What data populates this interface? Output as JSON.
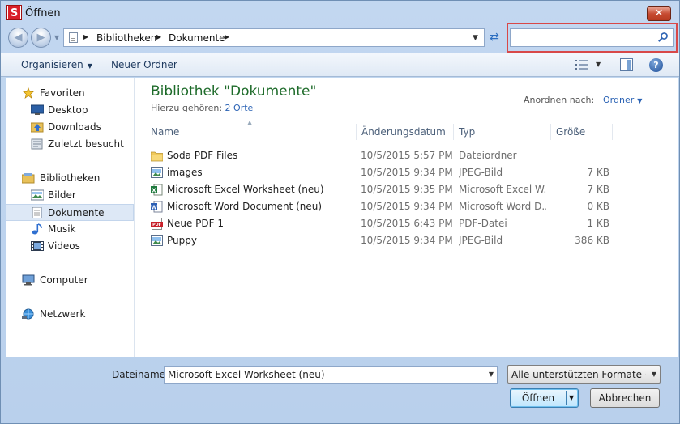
{
  "window": {
    "title": "Öffnen",
    "app_icon_letter": "S",
    "close_label": "✕"
  },
  "address": {
    "crumbs": [
      "Bibliotheken",
      "Dokumente"
    ]
  },
  "search": {
    "value": "",
    "placeholder": ""
  },
  "toolbar": {
    "organize_label": "Organisieren",
    "new_folder_label": "Neuer Ordner"
  },
  "sidebar": {
    "favorites": {
      "label": "Favoriten",
      "items": [
        "Desktop",
        "Downloads",
        "Zuletzt besucht"
      ]
    },
    "libraries": {
      "label": "Bibliotheken",
      "items": [
        "Bilder",
        "Dokumente",
        "Musik",
        "Videos"
      ]
    },
    "computer": "Computer",
    "network": "Netzwerk",
    "selected": "Dokumente"
  },
  "library": {
    "title": "Bibliothek \"Dokumente\"",
    "subtitle_prefix": "Hierzu gehören:",
    "subtitle_link": "2 Orte",
    "arrange_label": "Anordnen nach:",
    "arrange_value": "Ordner"
  },
  "columns": {
    "name": "Name",
    "date": "Änderungsdatum",
    "type": "Typ",
    "size": "Größe"
  },
  "files": [
    {
      "name": "Soda PDF Files",
      "date": "10/5/2015 5:57 PM",
      "type": "Dateiordner",
      "size": "",
      "icon": "folder-icon"
    },
    {
      "name": "images",
      "date": "10/5/2015 9:34 PM",
      "type": "JPEG-Bild",
      "size": "7 KB",
      "icon": "image-icon"
    },
    {
      "name": "Microsoft Excel Worksheet (neu)",
      "date": "10/5/2015 9:35 PM",
      "type": "Microsoft Excel W...",
      "size": "7 KB",
      "icon": "excel-icon"
    },
    {
      "name": "Microsoft Word Document (neu)",
      "date": "10/5/2015 9:34 PM",
      "type": "Microsoft Word D...",
      "size": "0 KB",
      "icon": "word-icon"
    },
    {
      "name": "Neue PDF 1",
      "date": "10/5/2015 6:43 PM",
      "type": "PDF-Datei",
      "size": "1 KB",
      "icon": "pdf-icon"
    },
    {
      "name": "Puppy",
      "date": "10/5/2015 9:34 PM",
      "type": "JPEG-Bild",
      "size": "386 KB",
      "icon": "image-icon"
    }
  ],
  "footer": {
    "filename_label": "Dateiname:",
    "filename_value": "Microsoft Excel Worksheet (neu)",
    "filter_value": "Alle unterstützten Formate (*.pdf",
    "open_label": "Öffnen",
    "cancel_label": "Abbrechen"
  }
}
